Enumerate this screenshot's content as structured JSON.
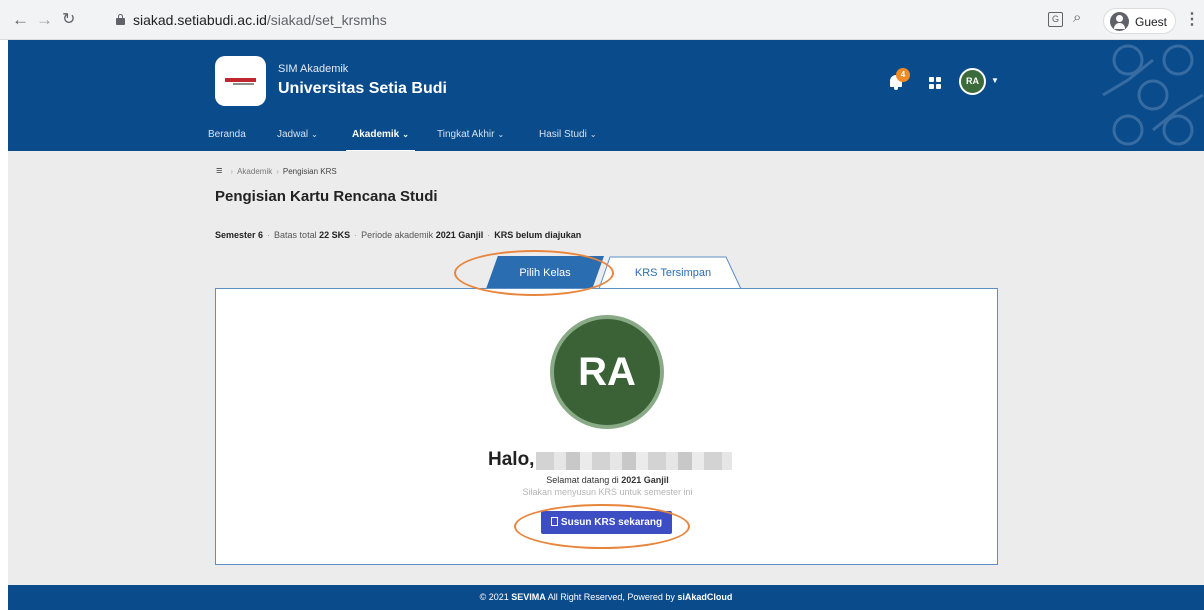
{
  "browser": {
    "back_icon": "arrow-left-icon",
    "forward_icon": "arrow-right-icon",
    "reload_icon": "reload-icon",
    "url_host": "siakad.setiabudi.ac.id",
    "url_path": "/siakad/set_krsmhs",
    "profile_name": "Guest"
  },
  "header": {
    "subtitle": "SIM Akademik",
    "title": "Universitas Setia Budi",
    "notification_count": "4",
    "avatar_initials": "RA",
    "brand_color": "#0a4b8c"
  },
  "nav": {
    "items": [
      {
        "label": "Beranda"
      },
      {
        "label": "Jadwal",
        "caret": "⌄"
      },
      {
        "label": "Akademik",
        "caret": "⌄"
      },
      {
        "label": "Tingkat Akhir",
        "caret": "⌄"
      },
      {
        "label": "Hasil Studi",
        "caret": "⌄"
      }
    ],
    "active": "Akademik"
  },
  "breadcrumb": {
    "items": [
      "Akademik",
      "Pengisian KRS"
    ]
  },
  "page": {
    "title": "Pengisian Kartu Rencana Studi",
    "semester": "Semester 6",
    "batas_prefix": "Batas total",
    "batas_value": "22 SKS",
    "periode_prefix": "Periode akademik",
    "periode_value": "2021 Ganjil",
    "status": "KRS belum diajukan"
  },
  "tabs": [
    {
      "label": "Pilih Kelas",
      "active": true
    },
    {
      "label": "KRS Tersimpan",
      "active": false
    }
  ],
  "panel": {
    "avatar_initials": "RA",
    "greeting": "Halo,",
    "welcome_prefix": "Selamat datang di",
    "welcome_period": "2021 Ganjil",
    "hint": "Silakan menyusun KRS untuk semester ini",
    "button_label": "Susun KRS sekarang"
  },
  "footer": {
    "prefix": "© 2021",
    "brand": "SEVIMA",
    "middle": "All Right Reserved, Powered by",
    "powered": "siAkadCloud"
  }
}
